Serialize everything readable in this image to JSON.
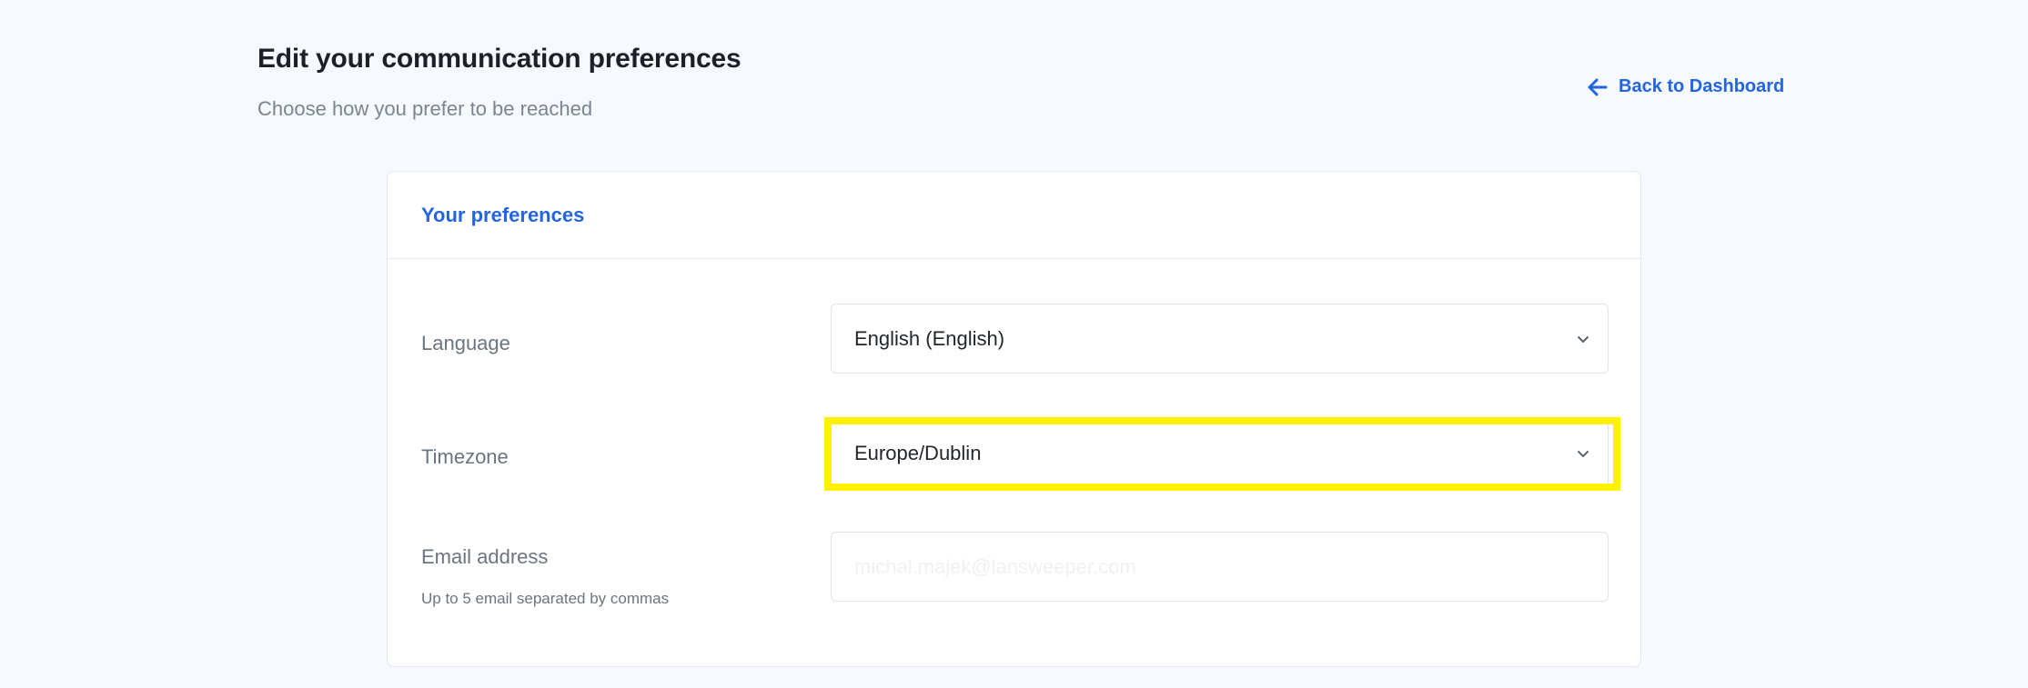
{
  "header": {
    "title": "Edit your communication preferences",
    "subtitle": "Choose how you prefer to be reached",
    "back_link": "Back to Dashboard"
  },
  "card": {
    "title": "Your preferences",
    "fields": {
      "language": {
        "label": "Language",
        "value": "English (English)"
      },
      "timezone": {
        "label": "Timezone",
        "value": "Europe/Dublin"
      },
      "email": {
        "label": "Email address",
        "hint": "Up to 5 email separated by commas",
        "placeholder": "michal.majek@lansweeper.com",
        "value": ""
      }
    }
  },
  "colors": {
    "accent": "#2364e0",
    "highlight": "#fff200",
    "background": "#f6f9fd"
  },
  "icons": {
    "back": "arrow-left-icon",
    "dropdown": "chevron-down-icon"
  }
}
